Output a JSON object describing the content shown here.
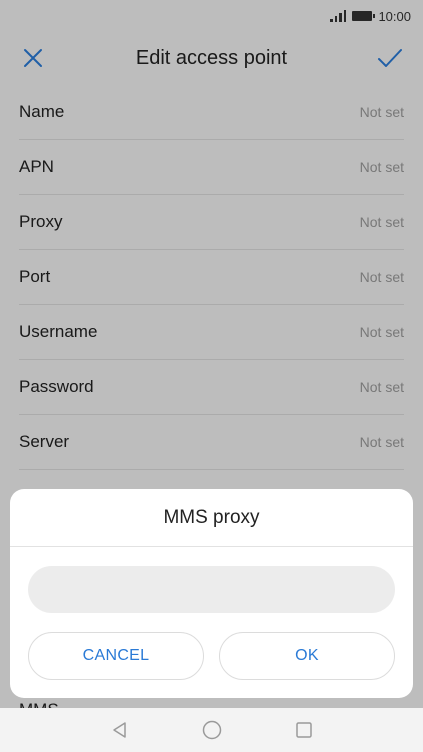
{
  "status_bar": {
    "time": "10:00"
  },
  "app_bar": {
    "title": "Edit access point",
    "close_icon": "close-icon",
    "confirm_icon": "check-icon"
  },
  "rows": [
    {
      "label": "Name",
      "value": "Not set"
    },
    {
      "label": "APN",
      "value": "Not set"
    },
    {
      "label": "Proxy",
      "value": "Not set"
    },
    {
      "label": "Port",
      "value": "Not set"
    },
    {
      "label": "Username",
      "value": "Not set"
    },
    {
      "label": "Password",
      "value": "Not set"
    },
    {
      "label": "Server",
      "value": "Not set"
    }
  ],
  "partial_row_label": "MMS",
  "dialog": {
    "title": "MMS proxy",
    "input_value": "",
    "cancel_label": "CANCEL",
    "ok_label": "OK"
  },
  "nav_bar": {
    "back_icon": "back-icon",
    "home_icon": "home-icon",
    "recents_icon": "recents-icon"
  },
  "colors": {
    "accent": "#2a7ad6",
    "background": "#f3f3f3"
  }
}
